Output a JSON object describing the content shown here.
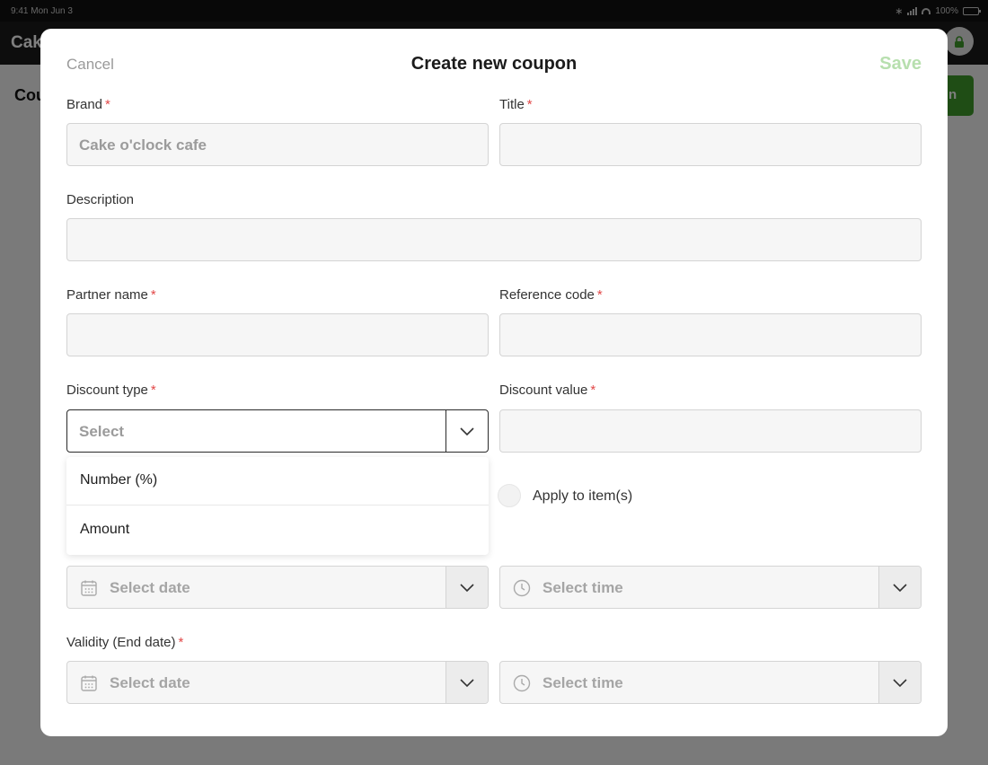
{
  "status_bar": {
    "time": "9:41  Mon Jun 3",
    "battery": "100%"
  },
  "background": {
    "app_title": "Cake",
    "page_heading": "Cou",
    "page_action": "n"
  },
  "modal": {
    "cancel_label": "Cancel",
    "title": "Create new coupon",
    "save_label": "Save",
    "required_mark": "*",
    "brand": {
      "label": "Brand",
      "value": "Cake o'clock cafe"
    },
    "title_field": {
      "label": "Title",
      "value": ""
    },
    "description": {
      "label": "Description",
      "value": ""
    },
    "partner_name": {
      "label": "Partner name",
      "value": ""
    },
    "reference_code": {
      "label": "Reference code",
      "value": ""
    },
    "discount_type": {
      "label": "Discount type",
      "placeholder": "Select",
      "options": [
        "Number (%)",
        "Amount"
      ]
    },
    "discount_value": {
      "label": "Discount value",
      "value": ""
    },
    "apply_to_items": {
      "label": "Apply to item(s)",
      "checked": false
    },
    "validity_start": {
      "date_placeholder": "Select date",
      "time_placeholder": "Select time"
    },
    "validity_end": {
      "label": "Validity (End date)",
      "date_placeholder": "Select date",
      "time_placeholder": "Select time"
    }
  },
  "colors": {
    "accent_green": "#3f9a2a",
    "save_disabled": "#b7dfae",
    "required": "#e24848"
  }
}
